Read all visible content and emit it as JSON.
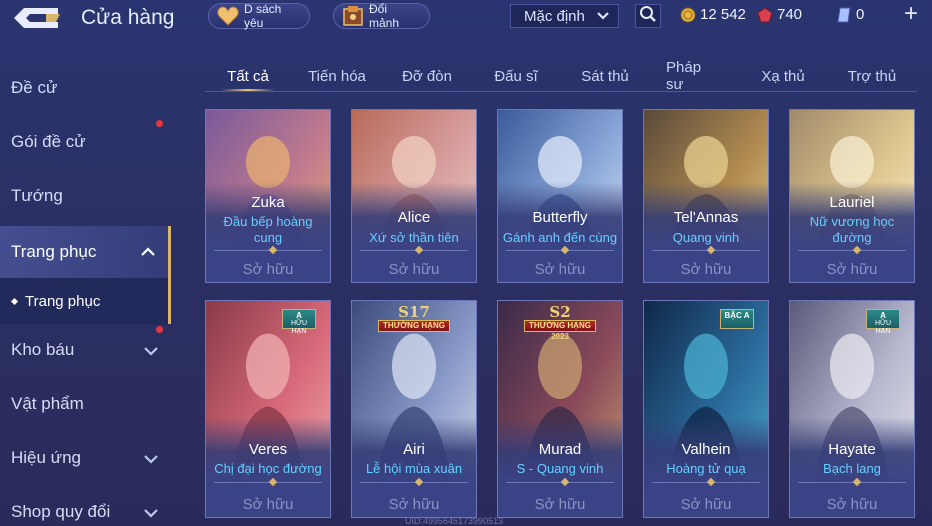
{
  "header": {
    "title": "Cửa hàng",
    "wishlist_label": "D sách yêu",
    "exchange_label": "Đổi mảnh",
    "sort_value": "Mặc định",
    "currencies": [
      {
        "name": "gold",
        "value": "12 542"
      },
      {
        "name": "ruby",
        "value": "740"
      },
      {
        "name": "voucher",
        "value": "0"
      }
    ],
    "plus": "+"
  },
  "sidebar": {
    "items": [
      {
        "label": "Đề cử"
      },
      {
        "label": "Gói đề cử"
      },
      {
        "label": "Tướng"
      },
      {
        "label": "Trang phục"
      },
      {
        "label": "Kho báu"
      },
      {
        "label": "Vật phẩm"
      },
      {
        "label": "Hiệu ứng"
      },
      {
        "label": "Shop quy đổi"
      }
    ],
    "sub_item": "Trang phục"
  },
  "tabs": [
    {
      "label": "Tất cả"
    },
    {
      "label": "Tiến hóa"
    },
    {
      "label": "Đỡ đòn"
    },
    {
      "label": "Đấu sĩ"
    },
    {
      "label": "Sát thủ"
    },
    {
      "label": "Pháp sư"
    },
    {
      "label": "Xạ thủ"
    },
    {
      "label": "Trợ thủ"
    }
  ],
  "cards": [
    {
      "hero": "Zuka",
      "skin": "Đầu bếp hoàng cung",
      "status": "Sở hữu",
      "colors": [
        "#7a5a9a",
        "#c07a8e",
        "#e8b070"
      ]
    },
    {
      "hero": "Alice",
      "skin": "Xứ sở thần tiên",
      "status": "Sở hữu",
      "colors": [
        "#b86a5a",
        "#d8a0a0",
        "#f0d0c0"
      ]
    },
    {
      "hero": "Butterfly",
      "skin": "Gánh anh đến cùng",
      "status": "Sở hữu",
      "colors": [
        "#3a5a9a",
        "#8aa8d8",
        "#e0e8f8"
      ]
    },
    {
      "hero": "Tel'Annas",
      "skin": "Quang vinh",
      "status": "Sở hữu",
      "colors": [
        "#5a4a3a",
        "#b08a50",
        "#e8d090"
      ]
    },
    {
      "hero": "Lauriel",
      "skin": "Nữ vương học đường",
      "status": "Sở hữu",
      "colors": [
        "#a08a6a",
        "#e0c890",
        "#f8ecd0"
      ]
    },
    {
      "hero": "Veres",
      "skin": "Chị đại học đường",
      "status": "Sở hữu",
      "colors": [
        "#8a3a4a",
        "#d86a7a",
        "#f0b0b0"
      ],
      "badge": {
        "type": "tier",
        "line1": "A",
        "line2": "HỮU HẠN"
      }
    },
    {
      "hero": "Airi",
      "skin": "Lễ hội mùa xuân",
      "status": "Sở hữu",
      "colors": [
        "#3a4a7a",
        "#8a9ac8",
        "#d8e0f0"
      ],
      "badge": {
        "type": "season",
        "season": "S17",
        "rank": "THƯỜNG HẠNG",
        "year": ""
      }
    },
    {
      "hero": "Murad",
      "skin": "S - Quang vinh",
      "status": "Sở hữu",
      "colors": [
        "#3a2a4a",
        "#8a4a5a",
        "#c8a070"
      ],
      "badge": {
        "type": "season",
        "season": "S2",
        "rank": "THƯỜNG HẠNG",
        "year": "2023"
      }
    },
    {
      "hero": "Valhein",
      "skin": "Hoàng tử quạ",
      "status": "Sở hữu",
      "colors": [
        "#10284a",
        "#2a6a9a",
        "#4ab0d0"
      ],
      "badge": {
        "type": "tier",
        "line1": "BẬC A",
        "line2": ""
      }
    },
    {
      "hero": "Hayate",
      "skin": "Bạch lang",
      "status": "Sở hữu",
      "colors": [
        "#5a5a7a",
        "#b8b8d0",
        "#e8e8f0"
      ],
      "badge": {
        "type": "tier",
        "line1": "A",
        "line2": "HỮU HẠN"
      }
    }
  ],
  "footer": {
    "uid": "UID:4995645173990513"
  }
}
